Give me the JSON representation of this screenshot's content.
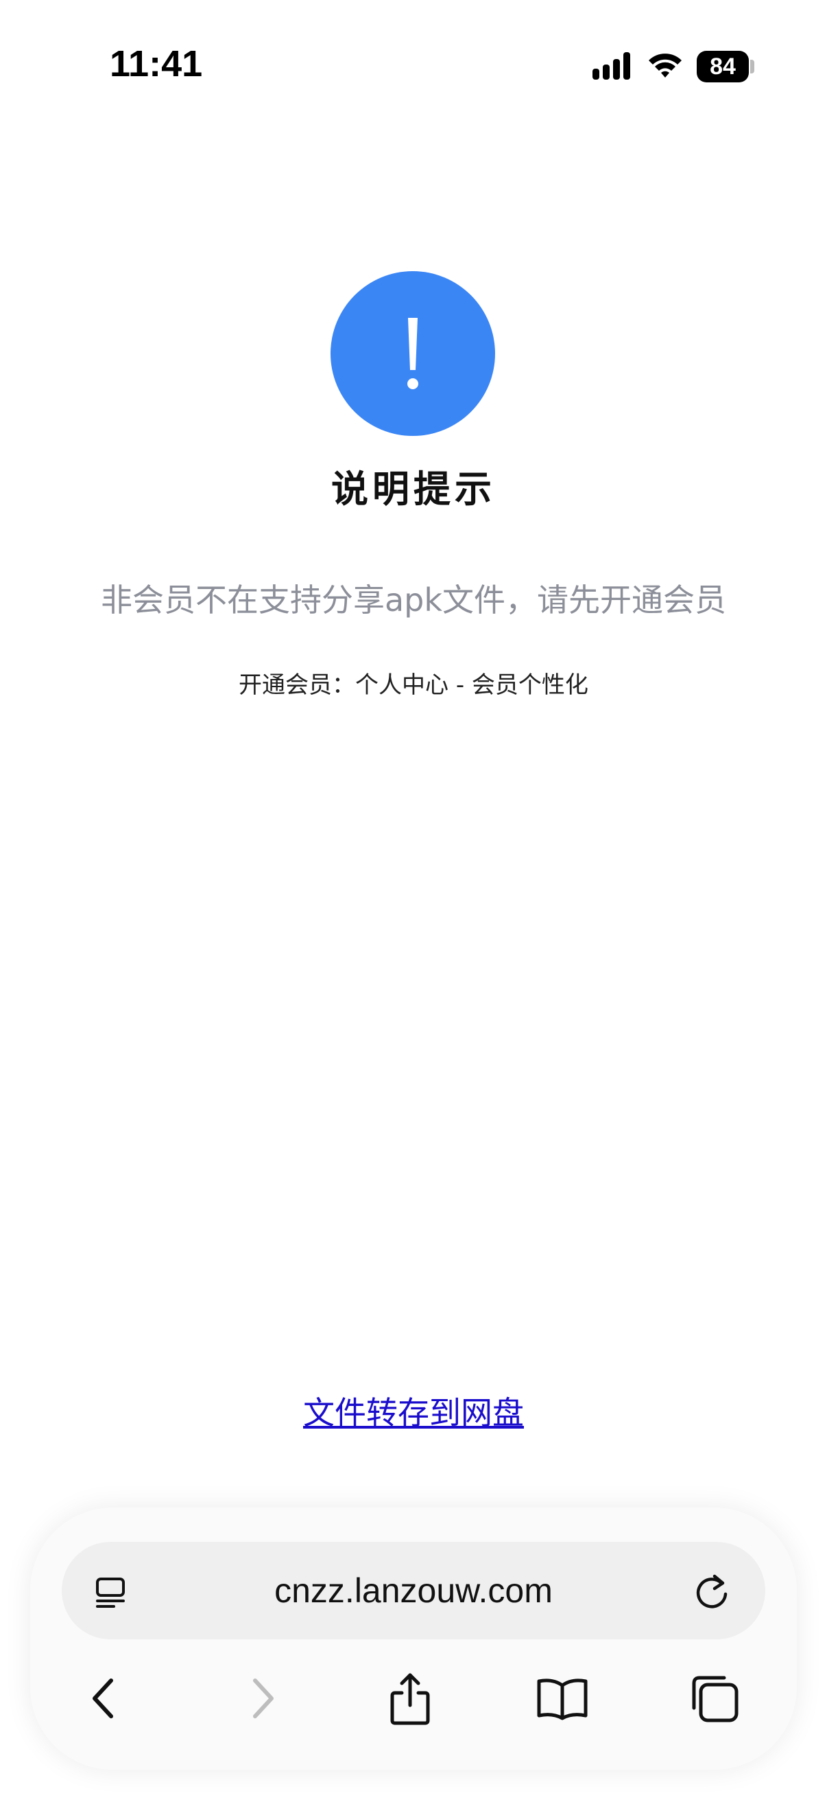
{
  "status_bar": {
    "time": "11:41",
    "battery": "84",
    "icons": [
      "signal-icon",
      "wifi-icon",
      "battery-icon"
    ]
  },
  "alert": {
    "icon": "exclamation-icon",
    "icon_color": "#3b86f5",
    "title": "说明提示",
    "message": "非会员不在支持分享apk文件，请先开通会员",
    "hint": "开通会员：个人中心 - 会员个性化",
    "link": "文件转存到网盘"
  },
  "browser": {
    "url": "cnzz.lanzouw.com",
    "icons": {
      "reader": "reader-mode-icon",
      "reload": "reload-icon",
      "back": "back-icon",
      "forward": "forward-icon",
      "share": "share-icon",
      "bookmarks": "bookmarks-icon",
      "tabs": "tabs-icon"
    }
  }
}
